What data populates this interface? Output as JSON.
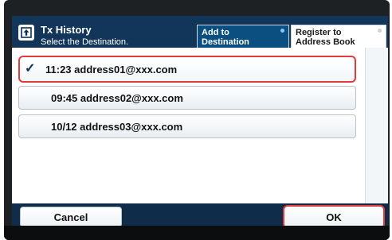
{
  "header": {
    "title": "Tx History",
    "subtitle": "Select the Destination.",
    "add_button": {
      "line1": "Add to",
      "line2": "Destination"
    },
    "register_button": {
      "line1": "Register to",
      "line2": "Address Book"
    }
  },
  "history": {
    "items": [
      {
        "label": "11:23 address01@xxx.com",
        "selected": true
      },
      {
        "label": "09:45 address02@xxx.com",
        "selected": false
      },
      {
        "label": "10/12 address03@xxx.com",
        "selected": false
      }
    ]
  },
  "footer": {
    "cancel_label": "Cancel",
    "ok_label": "OK"
  },
  "colors": {
    "header_bg": "#12355a",
    "highlight": "#e23b3b"
  }
}
